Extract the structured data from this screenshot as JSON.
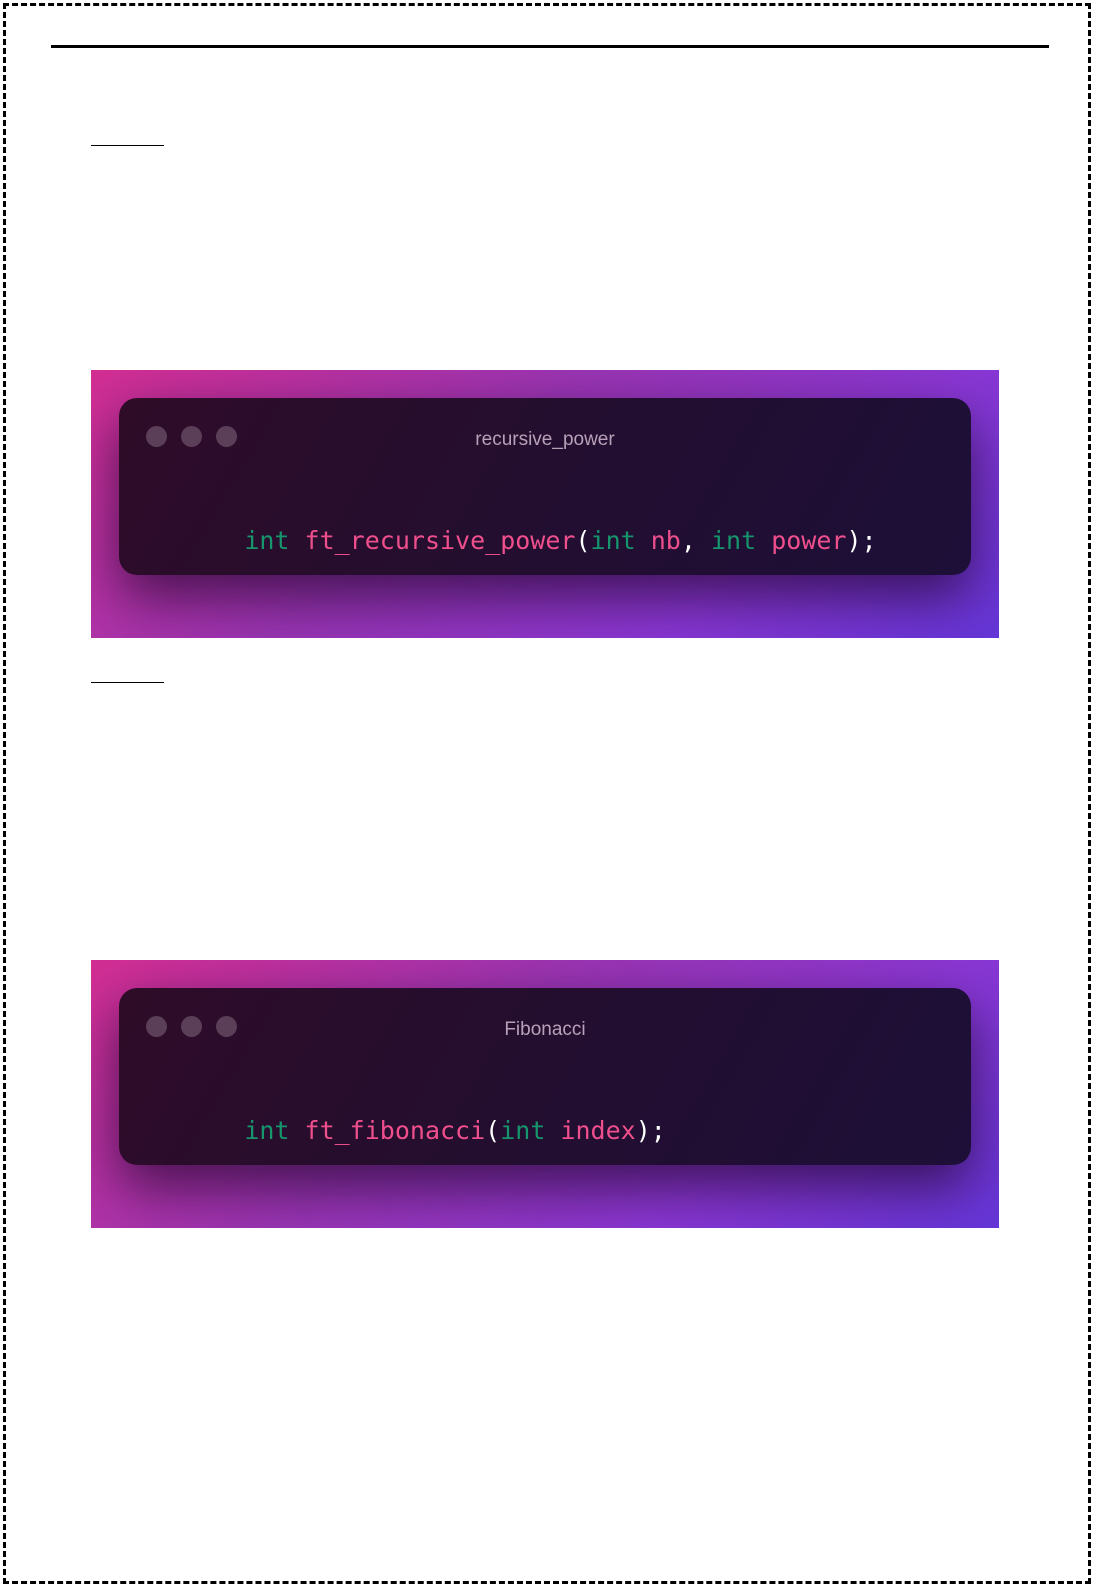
{
  "colors": {
    "keyword": "#16956c",
    "identifier": "#ef4f8c",
    "punctuation": "#ffffff",
    "window_title": "#b8a0b8"
  },
  "code_blocks": [
    {
      "title": "recursive_power",
      "tokens": [
        {
          "text": "int",
          "kind": "keyword"
        },
        {
          "text": " ",
          "kind": "space"
        },
        {
          "text": "ft_recursive_power",
          "kind": "function"
        },
        {
          "text": "(",
          "kind": "punctuation"
        },
        {
          "text": "int",
          "kind": "keyword"
        },
        {
          "text": " ",
          "kind": "space"
        },
        {
          "text": "nb",
          "kind": "identifier"
        },
        {
          "text": ",",
          "kind": "punctuation"
        },
        {
          "text": " ",
          "kind": "space"
        },
        {
          "text": "int",
          "kind": "keyword"
        },
        {
          "text": " ",
          "kind": "space"
        },
        {
          "text": "power",
          "kind": "identifier"
        },
        {
          "text": ");",
          "kind": "punctuation"
        }
      ]
    },
    {
      "title": "Fibonacci",
      "tokens": [
        {
          "text": "int",
          "kind": "keyword"
        },
        {
          "text": " ",
          "kind": "space"
        },
        {
          "text": "ft_fibonacci",
          "kind": "function"
        },
        {
          "text": "(",
          "kind": "punctuation"
        },
        {
          "text": "int",
          "kind": "keyword"
        },
        {
          "text": " ",
          "kind": "space"
        },
        {
          "text": "index",
          "kind": "identifier"
        },
        {
          "text": ");",
          "kind": "punctuation"
        }
      ]
    }
  ]
}
